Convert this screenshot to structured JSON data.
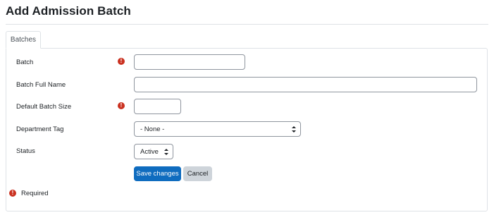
{
  "page": {
    "title": "Add Admission Batch"
  },
  "tabs": [
    {
      "label": "Batches",
      "active": true
    }
  ],
  "form": {
    "batch": {
      "label": "Batch",
      "value": "",
      "required": true
    },
    "batch_full_name": {
      "label": "Batch Full Name",
      "value": ""
    },
    "default_batch_size": {
      "label": "Default Batch Size",
      "value": "",
      "required": true
    },
    "department_tag": {
      "label": "Department Tag",
      "selected": "- None -"
    },
    "status": {
      "label": "Status",
      "selected": "Active"
    },
    "buttons": {
      "save": "Save changes",
      "cancel": "Cancel"
    },
    "required_note": "Required",
    "required_icon": "!"
  },
  "colors": {
    "primary": "#0f6cbf",
    "required": "#ca3120",
    "secondary_button": "#ced4da"
  },
  "icons": {
    "required": "exclamation-circle-icon",
    "select_caret": "updown-caret-icon"
  }
}
